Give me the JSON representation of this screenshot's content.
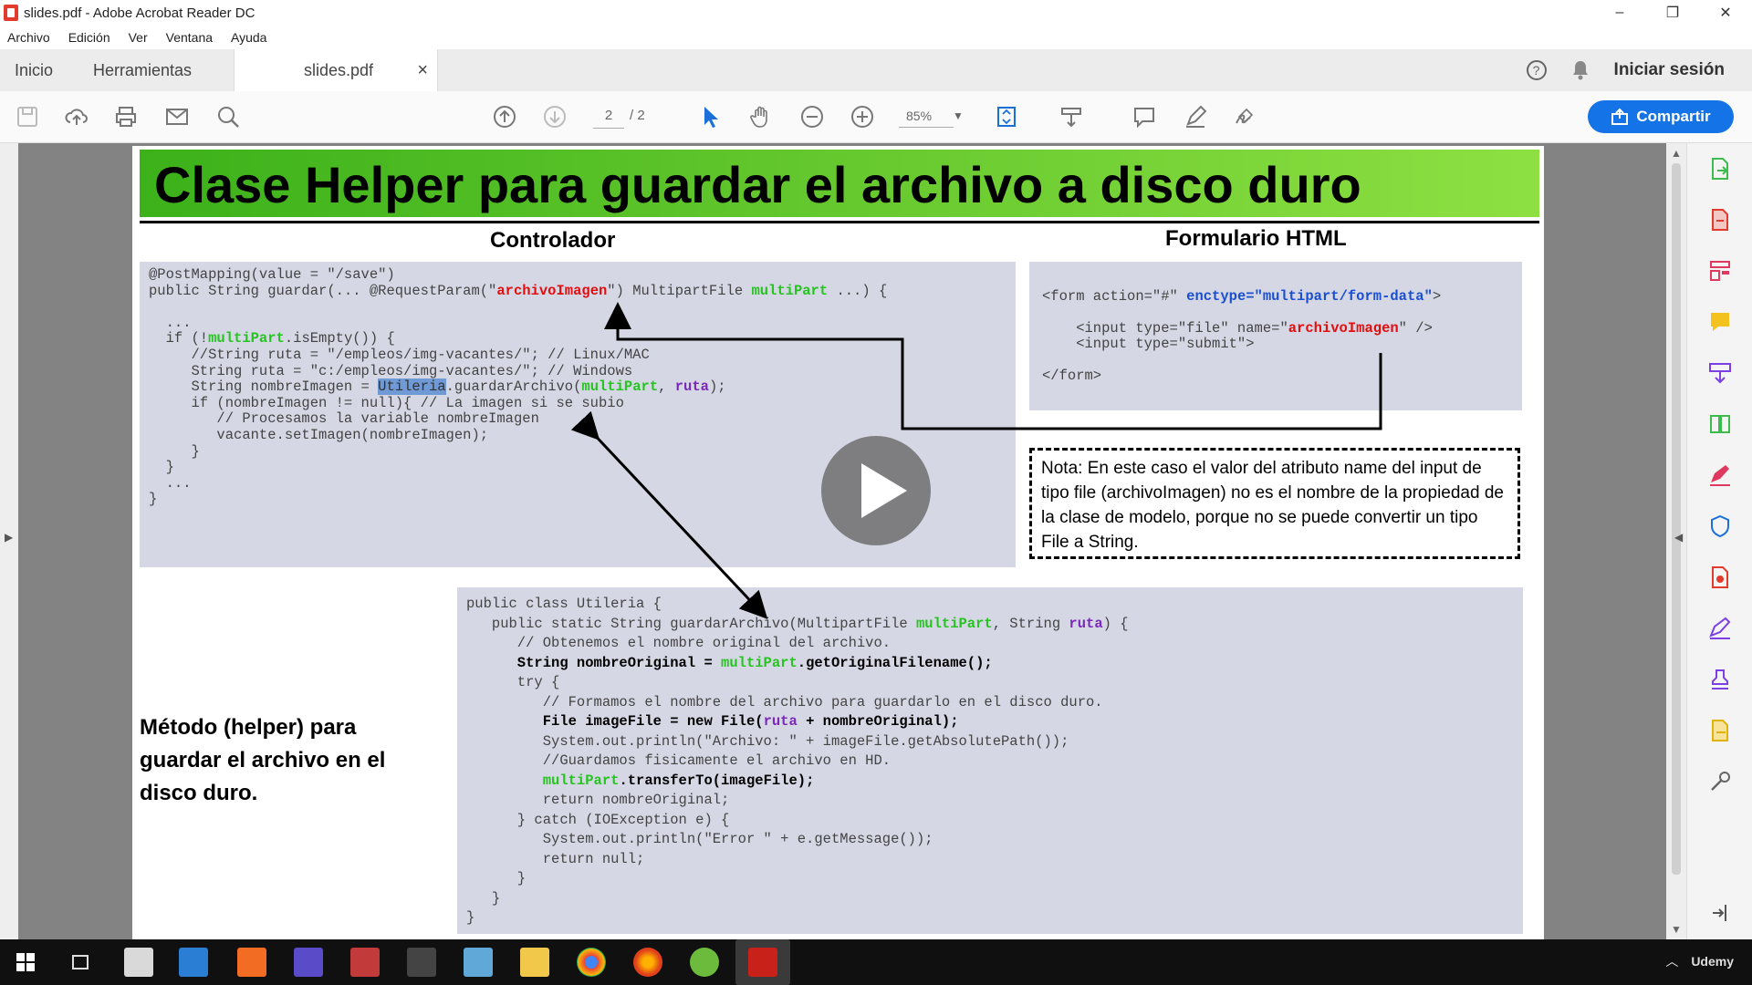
{
  "window": {
    "title": "slides.pdf - Adobe Acrobat Reader DC",
    "minimize": "–",
    "restore": "❐",
    "close": "✕"
  },
  "menu": [
    "Archivo",
    "Edición",
    "Ver",
    "Ventana",
    "Ayuda"
  ],
  "tabs": {
    "home": "Inicio",
    "tools": "Herramientas",
    "document": "slides.pdf",
    "close": "×"
  },
  "header_right": {
    "help": "?",
    "signin": "Iniciar sesión"
  },
  "toolbar": {
    "page_current": "2",
    "page_total": "/ 2",
    "zoom": "85%",
    "share_label": "Compartir"
  },
  "slide": {
    "title": "Clase Helper para guardar el archivo a disco duro",
    "controller_heading": "Controlador",
    "form_heading": "Formulario HTML",
    "note": "Nota: En este caso el valor del atributo name del input de tipo file (archivoImagen) no es el nombre de la propiedad de la clase de modelo, porque no se puede convertir un tipo File a String.",
    "method_caption": "Método (helper) para guardar el archivo en el disco duro.",
    "controller_code": [
      [
        {
          "t": "@PostMapping(value = \"/save\")"
        }
      ],
      [
        {
          "t": "public String guardar(... @RequestParam(\""
        },
        {
          "t": "archivoImagen",
          "c": "r"
        },
        {
          "t": "\") MultipartFile "
        },
        {
          "t": "multiPart",
          "c": "g"
        },
        {
          "t": " ...) {"
        }
      ],
      [
        {
          "t": ""
        }
      ],
      [
        {
          "t": "  ..."
        }
      ],
      [
        {
          "t": "  if (!"
        },
        {
          "t": "multiPart",
          "c": "g"
        },
        {
          "t": ".isEmpty()) {"
        }
      ],
      [
        {
          "t": "     //String ruta = \"/empleos/img-vacantes/\"; // Linux/MAC"
        }
      ],
      [
        {
          "t": "     String ruta = \"c:/empleos/img-vacantes/\"; // Windows"
        }
      ],
      [
        {
          "t": "     String nombreImagen = "
        },
        {
          "t": "Utileria",
          "c": "hl"
        },
        {
          "t": ".guardarArchivo("
        },
        {
          "t": "multiPart",
          "c": "g"
        },
        {
          "t": ", "
        },
        {
          "t": "ruta",
          "c": "p"
        },
        {
          "t": ");"
        }
      ],
      [
        {
          "t": "     if (nombreImagen != null){ // La imagen si se subio"
        }
      ],
      [
        {
          "t": "        // Procesamos la variable nombreImagen"
        }
      ],
      [
        {
          "t": "        vacante.setImagen(nombreImagen);"
        }
      ],
      [
        {
          "t": "     }"
        }
      ],
      [
        {
          "t": "  }"
        }
      ],
      [
        {
          "t": "  ..."
        }
      ],
      [
        {
          "t": "}"
        }
      ]
    ],
    "form_code": [
      [
        {
          "t": "<form action=\"#\" "
        },
        {
          "t": "enctype=\"multipart/form-data\"",
          "c": "b"
        },
        {
          "t": ">"
        }
      ],
      [
        {
          "t": ""
        }
      ],
      [
        {
          "t": "    <input type=\"file\" name=\""
        },
        {
          "t": "archivoImagen",
          "c": "r"
        },
        {
          "t": "\" />"
        }
      ],
      [
        {
          "t": "    <input type=\"submit\">"
        }
      ],
      [
        {
          "t": ""
        }
      ],
      [
        {
          "t": "</form>"
        }
      ]
    ],
    "helper_code": [
      [
        {
          "t": "public class Utileria {"
        }
      ],
      [
        {
          "t": "   public static String guardarArchivo(MultipartFile "
        },
        {
          "t": "multiPart",
          "c": "g"
        },
        {
          "t": ", String "
        },
        {
          "t": "ruta",
          "c": "p"
        },
        {
          "t": ") {"
        }
      ],
      [
        {
          "t": "      // Obtenemos el nombre original del archivo."
        }
      ],
      [
        {
          "t": "      String nombreOriginal = ",
          "c": "k"
        },
        {
          "t": "multiPart",
          "c": "g"
        },
        {
          "t": ".getOriginalFilename();",
          "c": "k"
        }
      ],
      [
        {
          "t": "      try {"
        }
      ],
      [
        {
          "t": "         // Formamos el nombre del archivo para guardarlo en el disco duro."
        }
      ],
      [
        {
          "t": "         File imageFile = new File(",
          "c": "k"
        },
        {
          "t": "ruta",
          "c": "p"
        },
        {
          "t": " + nombreOriginal);",
          "c": "k"
        }
      ],
      [
        {
          "t": "         System.out.println(\"Archivo: \" + imageFile.getAbsolutePath());"
        }
      ],
      [
        {
          "t": "         //Guardamos fisicamente el archivo en HD."
        }
      ],
      [
        {
          "t": "         "
        },
        {
          "t": "multiPart",
          "c": "g"
        },
        {
          "t": ".transferTo(imageFile);",
          "c": "k"
        }
      ],
      [
        {
          "t": "         return nombreOriginal;"
        }
      ],
      [
        {
          "t": "      } catch (IOException e) {"
        }
      ],
      [
        {
          "t": "         System.out.println(\"Error \" + e.getMessage());"
        }
      ],
      [
        {
          "t": "         return null;"
        }
      ],
      [
        {
          "t": "      }"
        }
      ],
      [
        {
          "t": "   }"
        }
      ],
      [
        {
          "t": "}"
        }
      ]
    ]
  },
  "tray": {
    "label": "Udemy"
  },
  "colors": {
    "share_blue": "#1473e6",
    "banner_green": "#3cb11a",
    "code_bg": "#d5d7e4"
  }
}
